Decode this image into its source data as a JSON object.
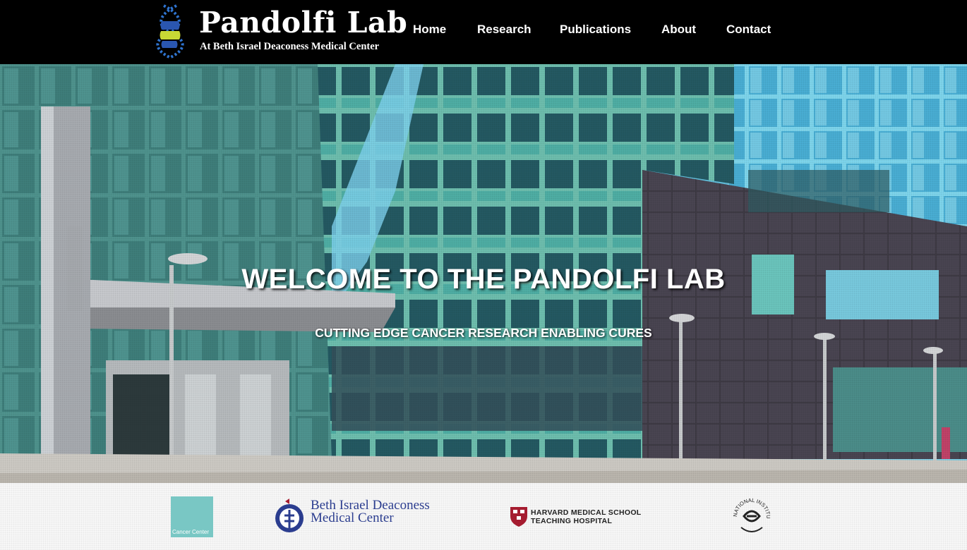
{
  "header": {
    "logo": {
      "title": "Pandolfi Lab",
      "subtitle": "At Beth Israel Deaconess Medical Center"
    },
    "nav": [
      {
        "label": "Home"
      },
      {
        "label": "Research"
      },
      {
        "label": "Publications"
      },
      {
        "label": "About"
      },
      {
        "label": "Contact"
      }
    ]
  },
  "hero": {
    "title": "WELCOME TO THE PANDOLFI LAB",
    "subtitle": "CUTTING EDGE CANCER RESEARCH ENABLING CURES"
  },
  "partners": {
    "cancer_center": "Cancer Center",
    "bidmc": {
      "line1": "Beth Israel Deaconess",
      "line2": "Medical Center"
    },
    "harvard": {
      "line1": "HARVARD MEDICAL SCHOOL",
      "line2": "TEACHING HOSPITAL"
    },
    "nih": "NATIONAL INSTITUTES OF HEALTH"
  },
  "colors": {
    "header_bg": "#000000",
    "bidmc_blue": "#2b3d8f",
    "harvard_red": "#a51c30",
    "cancer_teal": "#79c7c4"
  }
}
